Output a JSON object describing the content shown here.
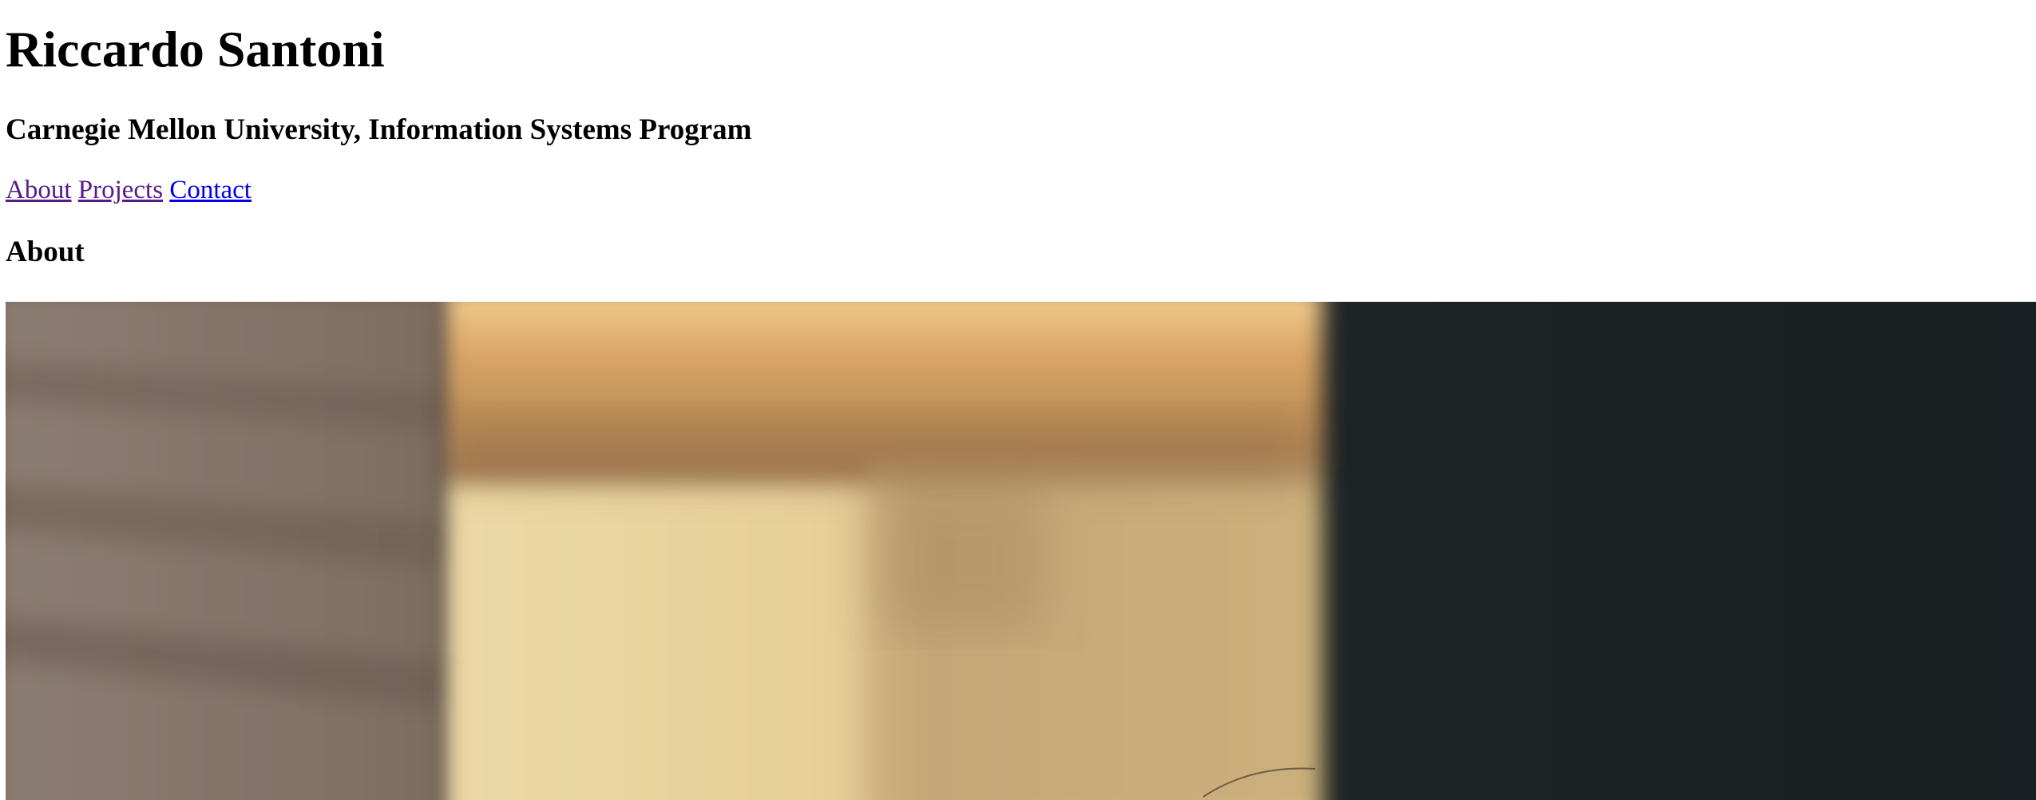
{
  "header": {
    "name": "Riccardo Santoni",
    "affiliation": "Carnegie Mellon University, Information Systems Program"
  },
  "nav": {
    "about": "About",
    "projects": "Projects",
    "contact": "Contact"
  },
  "sections": {
    "about_heading": "About"
  },
  "colors": {
    "visited_link": "#551a8b",
    "unvisited_link": "#0000ee",
    "photo_dark": "#1b2122"
  }
}
